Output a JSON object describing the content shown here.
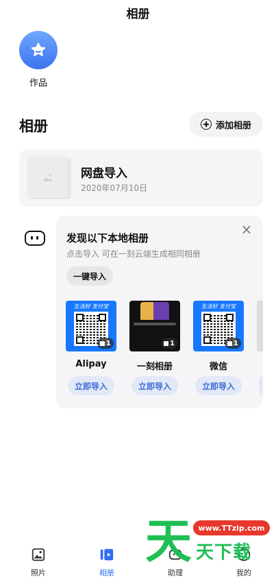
{
  "header": {
    "title": "相册"
  },
  "works": {
    "label": "作品"
  },
  "albums": {
    "title": "相册",
    "add_label": "添加相册",
    "items": [
      {
        "name": "网盘导入",
        "date": "2020年07月10日"
      }
    ]
  },
  "discover": {
    "title": "发现以下本地相册",
    "subtitle": "点击导入 可在一刻云端生成相同相册",
    "close": "×",
    "import_all": "一键导入",
    "albums": [
      {
        "name": "Alipay",
        "count": "1",
        "banner": "生活好 支付宝",
        "button": "立即导入"
      },
      {
        "name": "一刻相册",
        "count": "1",
        "button": "立即导入"
      },
      {
        "name": "微信",
        "count": "1",
        "banner": "生活好 支付宝",
        "button": "立即导入"
      }
    ]
  },
  "tabs": [
    {
      "label": "照片",
      "icon": "image-icon"
    },
    {
      "label": "相册",
      "icon": "album-icon",
      "active": true
    },
    {
      "label": "助理",
      "icon": "assistant-icon"
    },
    {
      "label": "我的",
      "icon": "profile-icon"
    }
  ],
  "watermark": {
    "url": "www.TTzip.com",
    "big": "天",
    "small": "天下载"
  },
  "colors": {
    "accent": "#2f6ef0",
    "card": "#f5f5f7",
    "tile_blue": "#1677ff"
  }
}
